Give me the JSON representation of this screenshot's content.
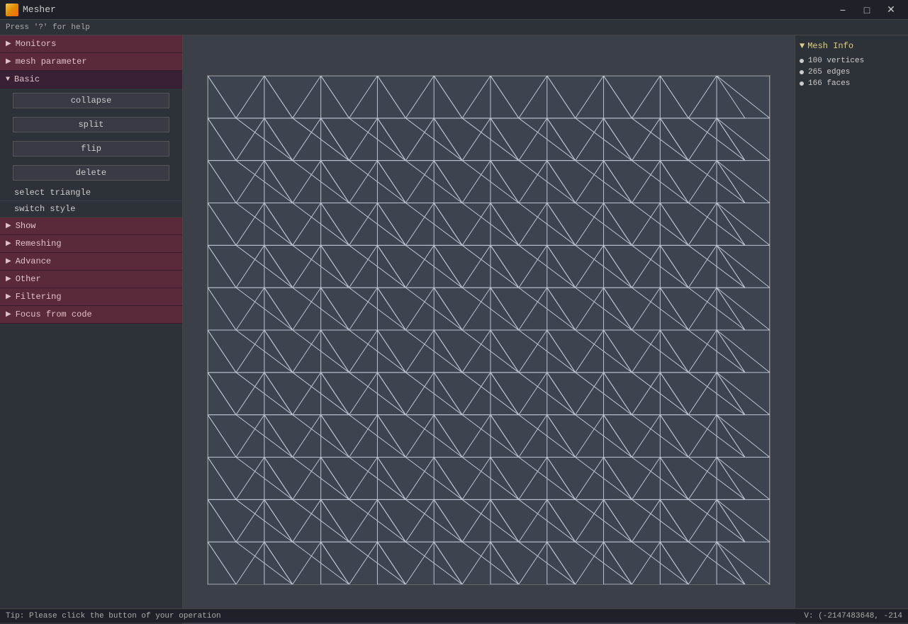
{
  "titlebar": {
    "app_name": "Mesher",
    "minimize_label": "−",
    "maximize_label": "□",
    "close_label": "✕"
  },
  "hint": "Press '?' for help",
  "sidebar": {
    "groups": [
      {
        "id": "monitors",
        "label": "Monitors",
        "expanded": false,
        "items": []
      },
      {
        "id": "mesh_parameter",
        "label": "mesh parameter",
        "expanded": false,
        "items": []
      },
      {
        "id": "basic",
        "label": "Basic",
        "expanded": true,
        "items": [
          {
            "type": "button",
            "label": "collapse"
          },
          {
            "type": "button",
            "label": "split"
          },
          {
            "type": "button",
            "label": "flip"
          },
          {
            "type": "button",
            "label": "delete"
          },
          {
            "type": "text",
            "label": "select triangle"
          },
          {
            "type": "text",
            "label": "switch style"
          }
        ]
      },
      {
        "id": "show",
        "label": "Show",
        "expanded": false,
        "items": []
      },
      {
        "id": "remeshing",
        "label": "Remeshing",
        "expanded": false,
        "items": []
      },
      {
        "id": "advance",
        "label": "Advance",
        "expanded": false,
        "items": []
      },
      {
        "id": "other",
        "label": "Other",
        "expanded": false,
        "items": []
      },
      {
        "id": "filtering",
        "label": "Filtering",
        "expanded": false,
        "items": []
      },
      {
        "id": "focus_from_code",
        "label": "Focus from code",
        "expanded": false,
        "items": []
      }
    ]
  },
  "mesh_info": {
    "title": "Mesh Info",
    "vertices": "100 vertices",
    "edges": "265 edges",
    "faces": "166 faces"
  },
  "statusbar": {
    "tip": "Tip: Please click the button of your operation",
    "coords": "V: (-2147483648, -214"
  }
}
